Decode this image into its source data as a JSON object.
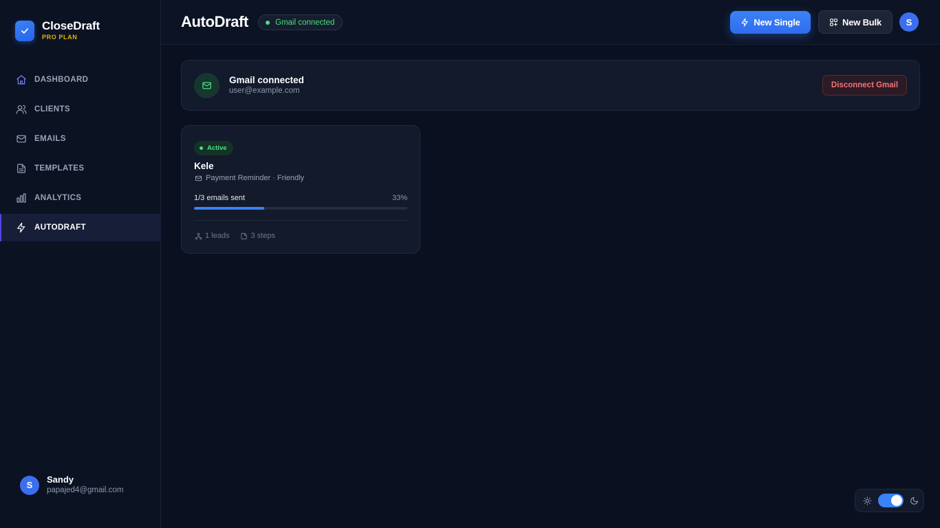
{
  "brand": {
    "name": "CloseDraft",
    "plan": "PRO PLAN"
  },
  "sidebar": {
    "items": [
      {
        "label": "DASHBOARD",
        "icon": "home-icon"
      },
      {
        "label": "CLIENTS",
        "icon": "users-icon"
      },
      {
        "label": "EMAILS",
        "icon": "mail-icon"
      },
      {
        "label": "TEMPLATES",
        "icon": "file-text-icon"
      },
      {
        "label": "ANALYTICS",
        "icon": "bar-chart-icon"
      },
      {
        "label": "AUTODRAFT",
        "icon": "lightning-icon",
        "active": true
      }
    ],
    "user": {
      "initial": "S",
      "name": "Sandy",
      "email": "papajed4@gmail.com"
    }
  },
  "header": {
    "title": "AutoDraft",
    "status_pill": "Gmail connected",
    "new_single_label": "New Single",
    "new_bulk_label": "New Bulk",
    "avatar_initial": "S"
  },
  "gmail_card": {
    "title": "Gmail connected",
    "email": "user@example.com",
    "disconnect_label": "Disconnect Gmail"
  },
  "draft_card": {
    "status": "Active",
    "name": "Kele",
    "meta": "Payment Reminder · Friendly",
    "progress_label": "1/3 emails sent",
    "progress_percent_text": "33%",
    "progress_fraction": 0.33,
    "leads": "1 leads",
    "steps": "3 steps"
  },
  "theme": {
    "mode": "dark"
  },
  "colors": {
    "accent": "#3b82f6",
    "success": "#4ade80",
    "danger": "#f87171",
    "plan": "#eab308",
    "active_indicator": "#4f46e5"
  }
}
